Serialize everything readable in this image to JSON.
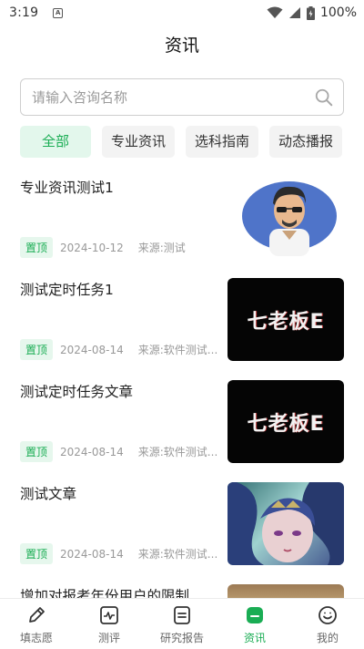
{
  "status_bar": {
    "time": "3:19",
    "notification_icon": "A",
    "battery": "100%"
  },
  "header": {
    "title": "资讯"
  },
  "search": {
    "placeholder": "请输入咨询名称"
  },
  "tabs": [
    {
      "label": "全部",
      "active": true
    },
    {
      "label": "专业资讯"
    },
    {
      "label": "选科指南"
    },
    {
      "label": "动态播报"
    }
  ],
  "articles": [
    {
      "title": "专业资讯测试1",
      "badge": "置顶",
      "date": "2024-10-12",
      "source": "来源:测试",
      "thumb": "cartoon-avatar"
    },
    {
      "title": "测试定时任务1",
      "badge": "置顶",
      "date": "2024-08-14",
      "source": "来源:软件测试...",
      "thumb": "dark-text-banner"
    },
    {
      "title": "测试定时任务文章",
      "badge": "置顶",
      "date": "2024-08-14",
      "source": "来源:软件测试...",
      "thumb": "dark-text-banner"
    },
    {
      "title": "测试文章",
      "badge": "置顶",
      "date": "2024-08-14",
      "source": "来源:软件测试...",
      "thumb": "game-character"
    },
    {
      "title": "增加对报考年份用户的限制,",
      "thumb": "photo"
    }
  ],
  "thumb_text": "七老板E",
  "bottom_nav": [
    {
      "label": "填志愿",
      "icon": "pencil-icon"
    },
    {
      "label": "测评",
      "icon": "chart-icon"
    },
    {
      "label": "研究报告",
      "icon": "report-icon"
    },
    {
      "label": "资讯",
      "icon": "news-icon",
      "active": true
    },
    {
      "label": "我的",
      "icon": "smile-icon"
    }
  ],
  "colors": {
    "accent": "#1aad54",
    "badge_bg": "#e6f7ed"
  }
}
